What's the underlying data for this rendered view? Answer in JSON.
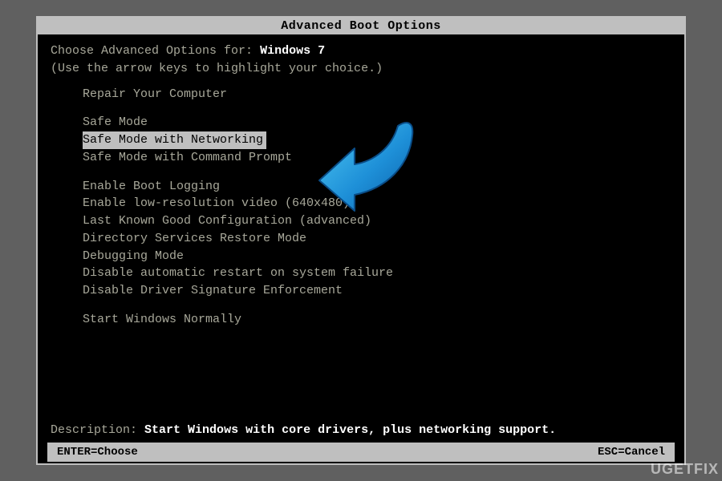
{
  "title": "Advanced Boot Options",
  "header": {
    "prefix": "Choose Advanced Options for:",
    "os": "Windows 7",
    "hint": "(Use the arrow keys to highlight your choice.)"
  },
  "groups": [
    {
      "items": [
        {
          "label": "Repair Your Computer",
          "selected": false
        }
      ]
    },
    {
      "items": [
        {
          "label": "Safe Mode",
          "selected": false
        },
        {
          "label": "Safe Mode with Networking",
          "selected": true
        },
        {
          "label": "Safe Mode with Command Prompt",
          "selected": false
        }
      ]
    },
    {
      "items": [
        {
          "label": "Enable Boot Logging",
          "selected": false
        },
        {
          "label": "Enable low-resolution video (640x480)",
          "selected": false
        },
        {
          "label": "Last Known Good Configuration (advanced)",
          "selected": false
        },
        {
          "label": "Directory Services Restore Mode",
          "selected": false
        },
        {
          "label": "Debugging Mode",
          "selected": false
        },
        {
          "label": "Disable automatic restart on system failure",
          "selected": false
        },
        {
          "label": "Disable Driver Signature Enforcement",
          "selected": false
        }
      ]
    },
    {
      "items": [
        {
          "label": "Start Windows Normally",
          "selected": false
        }
      ]
    }
  ],
  "description": {
    "prefix": "Description:",
    "text": "Start Windows with core drivers, plus networking support."
  },
  "status": {
    "left": "ENTER=Choose",
    "right": "ESC=Cancel"
  },
  "overlay": {
    "arrow_color": "#1e90d8",
    "arrow_name": "pointer-arrow-icon"
  },
  "watermark": "UGETFIX"
}
